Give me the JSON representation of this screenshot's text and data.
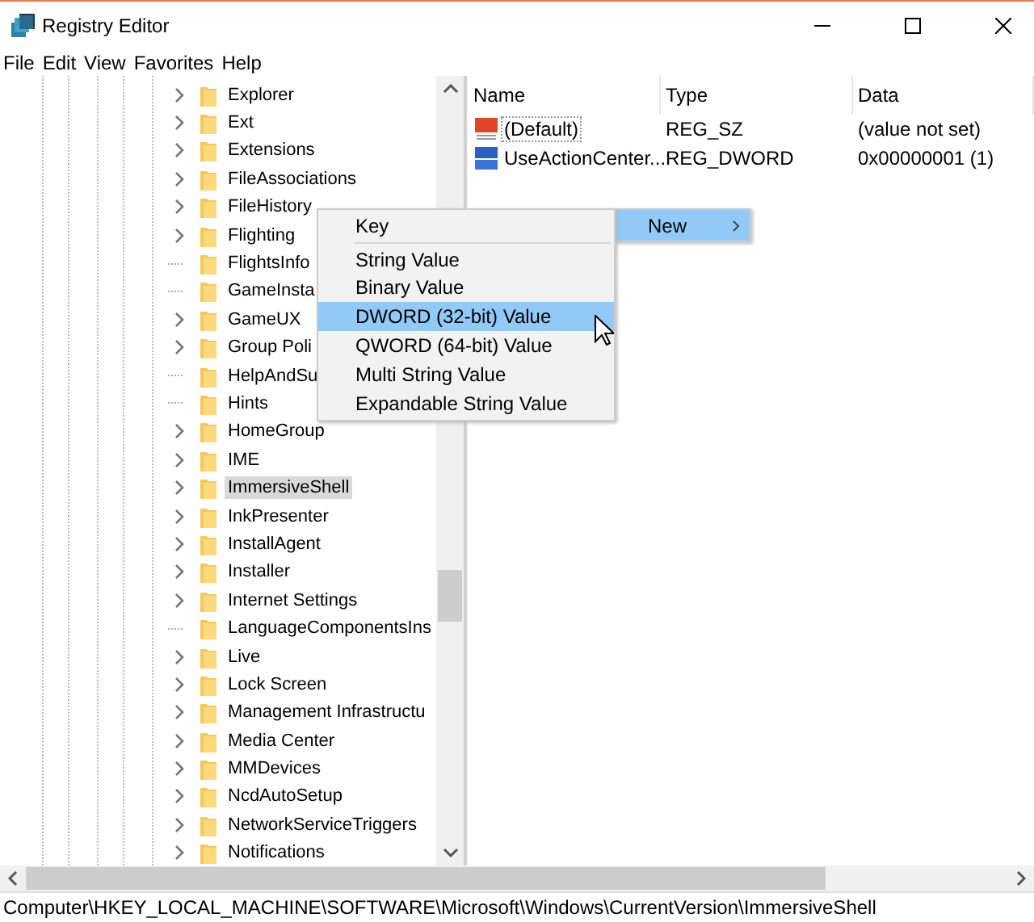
{
  "window": {
    "title": "Registry Editor"
  },
  "menu_bar": [
    {
      "label": "File"
    },
    {
      "label": "Edit"
    },
    {
      "label": "View"
    },
    {
      "label": "Favorites"
    },
    {
      "label": "Help"
    }
  ],
  "tree": {
    "items": [
      {
        "label": "Explorer",
        "expandable": true,
        "selected": false
      },
      {
        "label": "Ext",
        "expandable": true,
        "selected": false
      },
      {
        "label": "Extensions",
        "expandable": true,
        "selected": false
      },
      {
        "label": "FileAssociations",
        "expandable": true,
        "selected": false
      },
      {
        "label": "FileHistory",
        "expandable": true,
        "selected": false
      },
      {
        "label": "Flighting",
        "expandable": true,
        "selected": false
      },
      {
        "label": "FlightsInfo",
        "expandable": false,
        "selected": false
      },
      {
        "label": "GameInsta",
        "expandable": false,
        "selected": false
      },
      {
        "label": "GameUX",
        "expandable": true,
        "selected": false
      },
      {
        "label": "Group Poli",
        "expandable": true,
        "selected": false
      },
      {
        "label": "HelpAndSu",
        "expandable": false,
        "selected": false
      },
      {
        "label": "Hints",
        "expandable": false,
        "selected": false
      },
      {
        "label": "HomeGroup",
        "expandable": true,
        "selected": false
      },
      {
        "label": "IME",
        "expandable": true,
        "selected": false
      },
      {
        "label": "ImmersiveShell",
        "expandable": true,
        "selected": true
      },
      {
        "label": "InkPresenter",
        "expandable": true,
        "selected": false
      },
      {
        "label": "InstallAgent",
        "expandable": true,
        "selected": false
      },
      {
        "label": "Installer",
        "expandable": true,
        "selected": false
      },
      {
        "label": "Internet Settings",
        "expandable": true,
        "selected": false
      },
      {
        "label": "LanguageComponentsIns",
        "expandable": false,
        "selected": false
      },
      {
        "label": "Live",
        "expandable": true,
        "selected": false
      },
      {
        "label": "Lock Screen",
        "expandable": true,
        "selected": false
      },
      {
        "label": "Management Infrastructu",
        "expandable": true,
        "selected": false
      },
      {
        "label": "Media Center",
        "expandable": true,
        "selected": false
      },
      {
        "label": "MMDevices",
        "expandable": true,
        "selected": false
      },
      {
        "label": "NcdAutoSetup",
        "expandable": true,
        "selected": false
      },
      {
        "label": "NetworkServiceTriggers",
        "expandable": true,
        "selected": false
      },
      {
        "label": "Notifications",
        "expandable": true,
        "selected": false
      }
    ]
  },
  "list": {
    "columns": [
      "Name",
      "Type",
      "Data"
    ],
    "rows": [
      {
        "kind": "string",
        "name": "(Default)",
        "type": "REG_SZ",
        "data": "(value not set)",
        "focused": true
      },
      {
        "kind": "binary",
        "name": "UseActionCenter...",
        "type": "REG_DWORD",
        "data": "0x00000001 (1)",
        "focused": false
      }
    ]
  },
  "context_menu": {
    "items": [
      {
        "label": "New",
        "selected": true,
        "has_submenu": true
      }
    ],
    "submenu": [
      {
        "kind": "item",
        "label": "Key",
        "selected": false
      },
      {
        "kind": "separator"
      },
      {
        "kind": "item",
        "label": "String Value",
        "selected": false
      },
      {
        "kind": "item",
        "label": "Binary Value",
        "selected": false
      },
      {
        "kind": "item",
        "label": "DWORD (32-bit) Value",
        "selected": true
      },
      {
        "kind": "item",
        "label": "QWORD (64-bit) Value",
        "selected": false
      },
      {
        "kind": "item",
        "label": "Multi String Value",
        "selected": false
      },
      {
        "kind": "item",
        "label": "Expandable String Value",
        "selected": false
      }
    ]
  },
  "status_bar": {
    "path": "Computer\\HKEY_LOCAL_MACHINE\\SOFTWARE\\Microsoft\\Windows\\CurrentVersion\\ImmersiveShell"
  }
}
